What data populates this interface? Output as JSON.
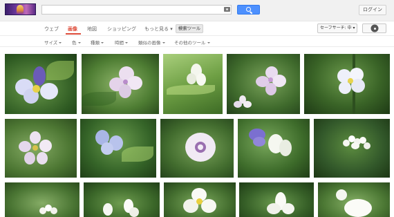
{
  "header": {
    "search_value": "",
    "login_label": "ログイン"
  },
  "nav": {
    "tabs": [
      {
        "label": "ウェブ",
        "active": false
      },
      {
        "label": "画像",
        "active": true
      },
      {
        "label": "地図",
        "active": false
      },
      {
        "label": "ショッピング",
        "active": false
      },
      {
        "label": "もっと見る ▾",
        "active": false
      }
    ],
    "tools_label": "検索ツール",
    "safesearch_label": "セーフサーチ: 中 ▾"
  },
  "filters": [
    {
      "label": "サイズ"
    },
    {
      "label": "色"
    },
    {
      "label": "種類"
    },
    {
      "label": "時間"
    },
    {
      "label": "類似の画像"
    },
    {
      "label": "その他のツール"
    }
  ],
  "colors": {
    "accent_red": "#dd4b39",
    "search_blue": "#4d90fe"
  }
}
